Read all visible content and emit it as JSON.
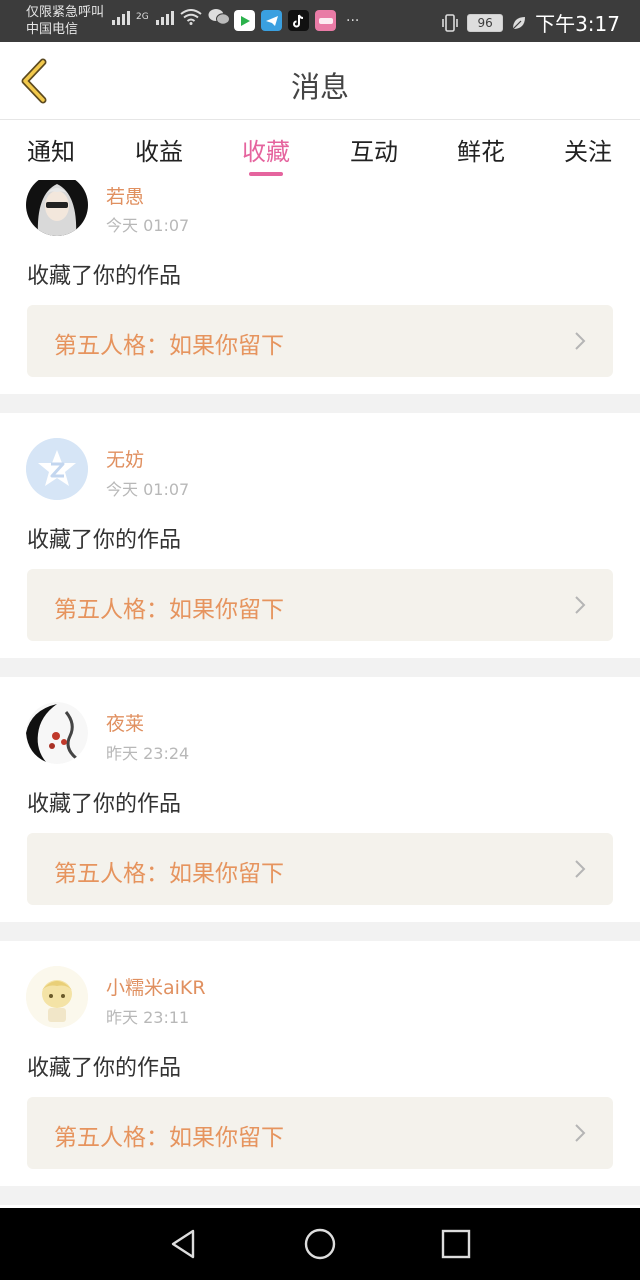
{
  "status_bar": {
    "carrier_line1": "仅限紧急呼叫",
    "carrier_line2": "中国电信",
    "network_type": "2G",
    "more": "···",
    "battery": "96",
    "time": "下午3:17",
    "icons": [
      "wifi-icon",
      "wechat-icon",
      "video-app-icon",
      "telegram-icon",
      "tiktok-icon",
      "lofter-app-icon",
      "vibrate-icon",
      "battery-icon",
      "leaf-icon"
    ]
  },
  "header": {
    "title": "消息",
    "back_icon": "chevron-left-icon",
    "accent": "#e5649e"
  },
  "tabs": [
    {
      "label": "通知",
      "active": false
    },
    {
      "label": "收益",
      "active": false
    },
    {
      "label": "收藏",
      "active": true
    },
    {
      "label": "互动",
      "active": false
    },
    {
      "label": "鲜花",
      "active": false
    },
    {
      "label": "关注",
      "active": false
    }
  ],
  "notifications": [
    {
      "user": "若愚",
      "time": "今天 01:07",
      "action": "收藏了你的作品",
      "work": "第五人格：如果你留下"
    },
    {
      "user": "无妨",
      "time": "今天 01:07",
      "action": "收藏了你的作品",
      "work": "第五人格：如果你留下"
    },
    {
      "user": "夜莱",
      "time": "昨天 23:24",
      "action": "收藏了你的作品",
      "work": "第五人格：如果你留下"
    },
    {
      "user": "小糯米aiKR",
      "time": "昨天 23:11",
      "action": "收藏了你的作品",
      "work": "第五人格：如果你留下"
    }
  ],
  "nav_bar": {
    "back_icon": "triangle-back-icon",
    "home_icon": "circle-home-icon",
    "recents_icon": "square-recents-icon"
  }
}
